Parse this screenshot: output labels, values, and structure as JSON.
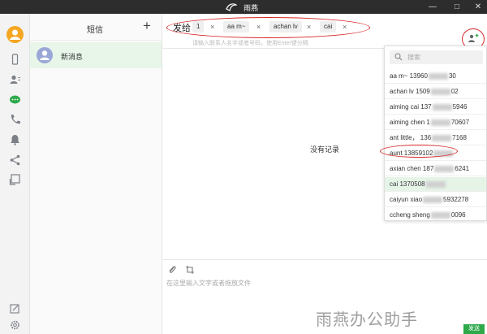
{
  "window": {
    "title": "雨燕",
    "controls": [
      "—",
      "□",
      "✕"
    ]
  },
  "rail": {
    "icons": [
      "phone-icon",
      "contacts-icon",
      "message-icon",
      "call-icon",
      "bell-icon",
      "share-icon",
      "cast-icon",
      "edit-icon",
      "settings-icon"
    ],
    "accent": "#2da94a"
  },
  "conversations": {
    "title": "短信",
    "add_label": "+",
    "items": [
      {
        "name": "新消息"
      }
    ]
  },
  "compose": {
    "to_label": "发给",
    "recipients": [
      "1",
      "aa m~",
      "achan lv",
      "cai"
    ],
    "remove_label": "×",
    "hint": "请输入联系人名字或者号码，使用Enter键分隔",
    "empty_text": "没有记录",
    "input_placeholder": "在这里输入文字或者拖放文件",
    "send_label": "发送",
    "watermark": "雨燕办公助手"
  },
  "dropdown": {
    "search_placeholder": "搜索",
    "contacts": [
      {
        "name": "aa m~ 13960",
        "tail": "30"
      },
      {
        "name": "achan lv 1509",
        "tail": "02"
      },
      {
        "name": "aiming cai 137",
        "tail": "5946"
      },
      {
        "name": "aiming chen 1",
        "tail": "70607"
      },
      {
        "name": "ant little， 136",
        "tail": "7168"
      },
      {
        "name": "aunt 13859102",
        "tail": ""
      },
      {
        "name": "axian chen 187",
        "tail": "6241"
      },
      {
        "name": "cai 1370508",
        "tail": ""
      },
      {
        "name": "caiyun xiao",
        "tail": "5932278"
      },
      {
        "name": "ccheng sheng",
        "tail": "0096"
      }
    ]
  }
}
